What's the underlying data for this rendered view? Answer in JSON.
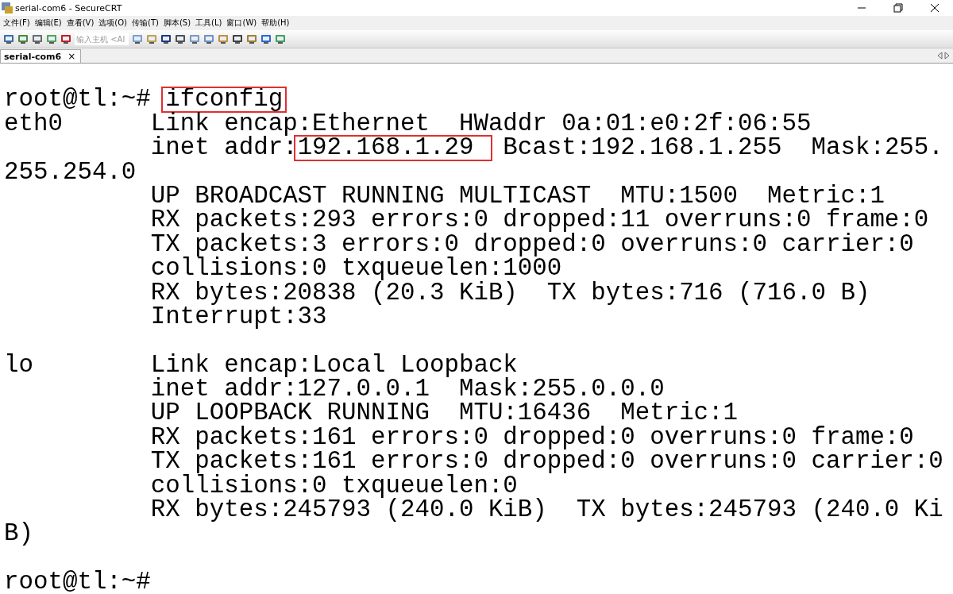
{
  "window": {
    "title": "serial-com6 - SecureCRT"
  },
  "menu": [
    "文件(F)",
    "编辑(E)",
    "查看(V)",
    "选项(O)",
    "传输(T)",
    "脚本(S)",
    "工具(L)",
    "窗口(W)",
    "帮助(H)"
  ],
  "toolbar": {
    "host_field": {
      "placeholder": "输入主机 <Al"
    }
  },
  "tabs": [
    {
      "label": "serial-com6",
      "close": "×",
      "selected": true
    }
  ],
  "terminal": {
    "blocks": [
      {
        "lines": [
          {
            "segments": [
              {
                "text": "root@tl:~# ",
                "highlighted": false
              },
              {
                "text": "ifconfig",
                "highlighted": true
              }
            ]
          },
          {
            "segments": [
              {
                "text": "eth0      Link encap:Ethernet  HWaddr 0a:01:e0:2f:06:55",
                "highlighted": false
              }
            ]
          },
          {
            "segments": [
              {
                "text": "          inet addr:",
                "highlighted": false
              },
              {
                "text": "192.168.1.29 ",
                "highlighted": true
              },
              {
                "text": " Bcast:192.168.1.255  Mask:255.",
                "highlighted": false
              }
            ]
          },
          {
            "segments": [
              {
                "text": "255.254.0",
                "highlighted": false
              }
            ]
          },
          {
            "segments": [
              {
                "text": "          UP BROADCAST RUNNING MULTICAST  MTU:1500  Metric:1",
                "highlighted": false
              }
            ]
          },
          {
            "segments": [
              {
                "text": "          RX packets:293 errors:0 dropped:11 overruns:0 frame:0",
                "highlighted": false
              }
            ]
          },
          {
            "segments": [
              {
                "text": "          TX packets:3 errors:0 dropped:0 overruns:0 carrier:0",
                "highlighted": false
              }
            ]
          },
          {
            "segments": [
              {
                "text": "          collisions:0 txqueuelen:1000",
                "highlighted": false
              }
            ]
          },
          {
            "segments": [
              {
                "text": "          RX bytes:20838 (20.3 KiB)  TX bytes:716 (716.0 B)",
                "highlighted": false
              }
            ]
          },
          {
            "segments": [
              {
                "text": "          Interrupt:33",
                "highlighted": false
              }
            ]
          }
        ]
      },
      {
        "lines": [
          {
            "segments": [
              {
                "text": "lo        Link encap:Local Loopback",
                "highlighted": false
              }
            ]
          },
          {
            "segments": [
              {
                "text": "          inet addr:127.0.0.1  Mask:255.0.0.0",
                "highlighted": false
              }
            ]
          },
          {
            "segments": [
              {
                "text": "          UP LOOPBACK RUNNING  MTU:16436  Metric:1",
                "highlighted": false
              }
            ]
          },
          {
            "segments": [
              {
                "text": "          RX packets:161 errors:0 dropped:0 overruns:0 frame:0",
                "highlighted": false
              }
            ]
          },
          {
            "segments": [
              {
                "text": "          TX packets:161 errors:0 dropped:0 overruns:0 carrier:0",
                "highlighted": false
              }
            ]
          },
          {
            "segments": [
              {
                "text": "          collisions:0 txqueuelen:0",
                "highlighted": false
              }
            ]
          },
          {
            "segments": [
              {
                "text": "          RX bytes:245793 (240.0 KiB)  TX bytes:245793 (240.0 Ki",
                "highlighted": false
              }
            ]
          },
          {
            "segments": [
              {
                "text": "B)",
                "highlighted": false
              }
            ]
          }
        ]
      },
      {
        "lines": [
          {
            "segments": [
              {
                "text": "root@tl:~# ",
                "highlighted": false
              }
            ]
          }
        ]
      }
    ]
  }
}
